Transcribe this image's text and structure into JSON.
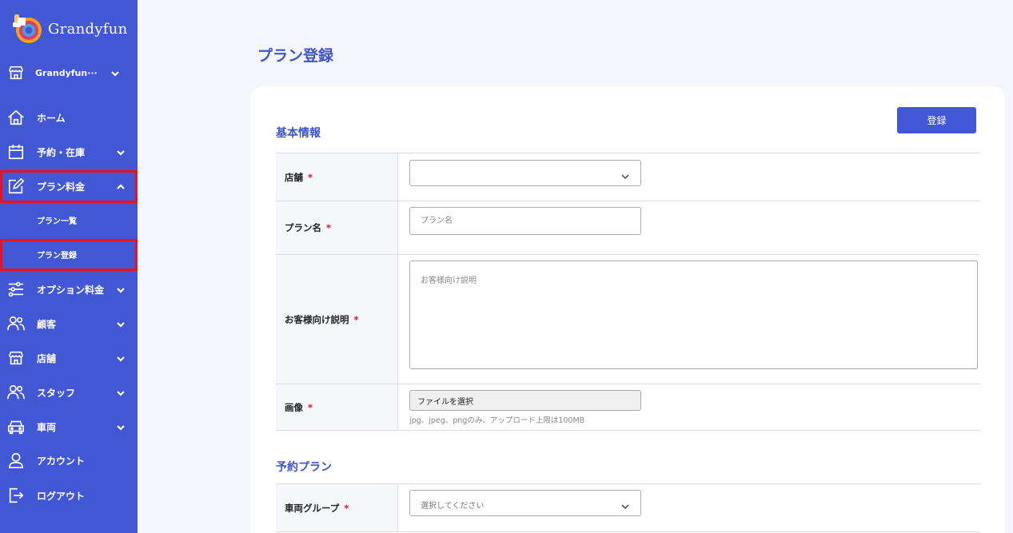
{
  "app": {
    "name": "Grandyfun"
  },
  "sidebar": {
    "store_selector": {
      "label": "Grandyfun···",
      "icon": "store-icon"
    },
    "items": [
      {
        "label": "ホーム",
        "icon": "home-icon"
      },
      {
        "label": "予約・在庫",
        "icon": "calendar-icon"
      },
      {
        "label": "プラン料金",
        "icon": "edit-icon"
      },
      {
        "label": "オプション料金",
        "icon": "sliders-icon"
      },
      {
        "label": "顧客",
        "icon": "users-icon"
      },
      {
        "label": "店舗",
        "icon": "store-icon"
      },
      {
        "label": "スタッフ",
        "icon": "users-icon"
      },
      {
        "label": "車両",
        "icon": "car-icon"
      },
      {
        "label": "アカウント",
        "icon": "user-icon"
      },
      {
        "label": "ログアウト",
        "icon": "logout-icon"
      }
    ],
    "plan_submenu": [
      {
        "label": "プラン一覧"
      },
      {
        "label": "プラン登録"
      }
    ],
    "accent_color": "#4257d4",
    "highlight_color": "#e8131c"
  },
  "main": {
    "page_title": "プラン登録",
    "register_button": "登録",
    "sections": {
      "basic": {
        "title": "基本情報",
        "store_label": "店舗",
        "plan_name_label": "プラン名",
        "plan_name_placeholder": "プラン名",
        "description_label": "お客様向け説明",
        "description_placeholder": "お客様向け説明",
        "image_label": "画像",
        "file_button": "ファイルを選択",
        "file_hint": "jpg、jpeg、pngのみ、アップロード上限は100MB"
      },
      "reservation": {
        "title": "予約プラン",
        "vehicle_group_label": "車両グループ",
        "vehicle_group_placeholder": "選択してください"
      }
    },
    "required_mark": "*"
  }
}
